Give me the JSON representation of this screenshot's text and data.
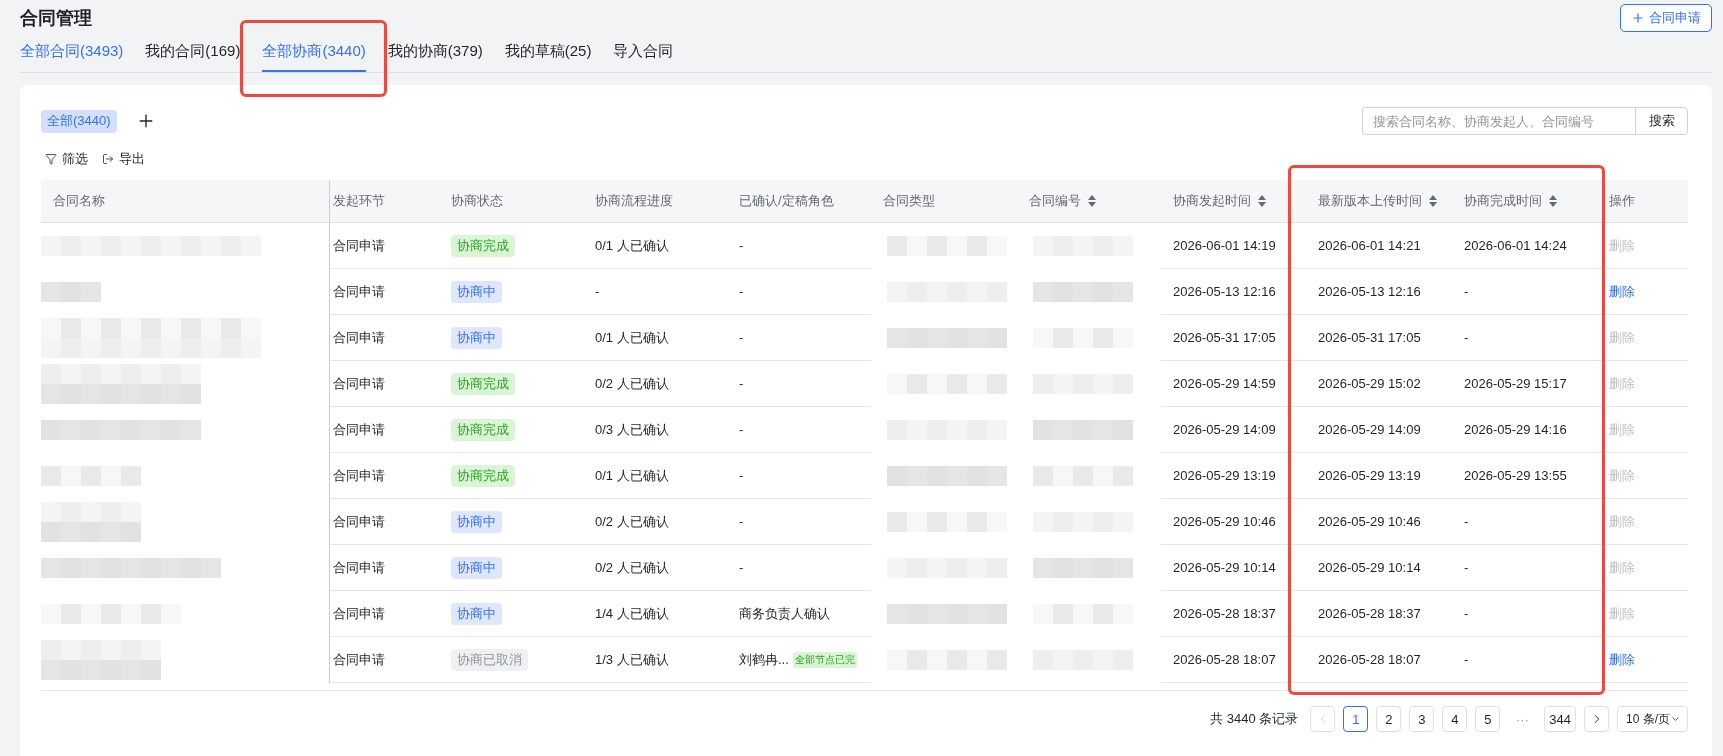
{
  "page": {
    "title": "合同管理",
    "new_button": {
      "label": "合同申请"
    }
  },
  "tabs": [
    {
      "label": "全部合同(3493)",
      "selected": false,
      "highlighted": true,
      "annotated": false
    },
    {
      "label": "我的合同(169)",
      "selected": false,
      "highlighted": false,
      "annotated": false
    },
    {
      "label": "全部协商(3440)",
      "selected": true,
      "highlighted": false,
      "annotated": true
    },
    {
      "label": "我的协商(379)",
      "selected": false,
      "highlighted": false,
      "annotated": false
    },
    {
      "label": "我的草稿(25)",
      "selected": false,
      "highlighted": false,
      "annotated": false
    },
    {
      "label": "导入合同",
      "selected": false,
      "highlighted": false,
      "annotated": false
    }
  ],
  "views": [
    {
      "label": "全部(3440)",
      "selected": true
    }
  ],
  "search": {
    "placeholder": "搜索合同名称、协商发起人、合同编号",
    "button": "搜索"
  },
  "tools": [
    {
      "label": "筛选",
      "kind": "filter"
    },
    {
      "label": "导出",
      "kind": "export"
    }
  ],
  "table": {
    "columns": [
      {
        "label": "合同名称",
        "sortable": false,
        "redacted": true,
        "annotated": false
      },
      {
        "label": "发起环节",
        "sortable": false,
        "redacted": false,
        "annotated": false
      },
      {
        "label": "协商状态",
        "sortable": false,
        "redacted": false,
        "annotated": false
      },
      {
        "label": "协商流程进度",
        "sortable": false,
        "redacted": false,
        "annotated": false
      },
      {
        "label": "已确认/定稿角色",
        "sortable": false,
        "redacted": false,
        "annotated": false
      },
      {
        "label": "合同类型",
        "sortable": false,
        "redacted": true,
        "annotated": false
      },
      {
        "label": "合同编号",
        "sortable": true,
        "redacted": true,
        "annotated": false
      },
      {
        "label": "协商发起时间",
        "sortable": true,
        "redacted": false,
        "annotated": false
      },
      {
        "label": "最新版本上传时间",
        "sortable": true,
        "redacted": false,
        "annotated": true
      },
      {
        "label": "协商完成时间",
        "sortable": true,
        "redacted": false,
        "annotated": true
      },
      {
        "label": "操作",
        "sortable": false,
        "redacted": false,
        "annotated": false
      }
    ],
    "rows": [
      {
        "stage": "合同申请",
        "status": {
          "label": "协商完成",
          "kind": "done"
        },
        "progress": "0/1 人已确认",
        "role": "-",
        "started": "2026-06-01 14:19",
        "latest_upload": "2026-06-01 14:21",
        "completed": "2026-06-01 14:24",
        "action": {
          "label": "删除",
          "disabled": true
        }
      },
      {
        "stage": "合同申请",
        "status": {
          "label": "协商中",
          "kind": "ongoing"
        },
        "progress": "-",
        "role": "-",
        "started": "2026-05-13 12:16",
        "latest_upload": "2026-05-13 12:16",
        "completed": "-",
        "action": {
          "label": "删除",
          "disabled": false
        }
      },
      {
        "stage": "合同申请",
        "status": {
          "label": "协商中",
          "kind": "ongoing"
        },
        "progress": "0/1 人已确认",
        "role": "-",
        "started": "2026-05-31 17:05",
        "latest_upload": "2026-05-31 17:05",
        "completed": "-",
        "action": {
          "label": "删除",
          "disabled": true
        }
      },
      {
        "stage": "合同申请",
        "status": {
          "label": "协商完成",
          "kind": "done"
        },
        "progress": "0/2 人已确认",
        "role": "-",
        "started": "2026-05-29 14:59",
        "latest_upload": "2026-05-29 15:02",
        "completed": "2026-05-29 15:17",
        "action": {
          "label": "删除",
          "disabled": true
        }
      },
      {
        "stage": "合同申请",
        "status": {
          "label": "协商完成",
          "kind": "done"
        },
        "progress": "0/3 人已确认",
        "role": "-",
        "started": "2026-05-29 14:09",
        "latest_upload": "2026-05-29 14:09",
        "completed": "2026-05-29 14:16",
        "action": {
          "label": "删除",
          "disabled": true
        }
      },
      {
        "stage": "合同申请",
        "status": {
          "label": "协商完成",
          "kind": "done"
        },
        "progress": "0/1 人已确认",
        "role": "-",
        "started": "2026-05-29 13:19",
        "latest_upload": "2026-05-29 13:19",
        "completed": "2026-05-29 13:55",
        "action": {
          "label": "删除",
          "disabled": true
        }
      },
      {
        "stage": "合同申请",
        "status": {
          "label": "协商中",
          "kind": "ongoing"
        },
        "progress": "0/2 人已确认",
        "role": "-",
        "started": "2026-05-29 10:46",
        "latest_upload": "2026-05-29 10:46",
        "completed": "-",
        "action": {
          "label": "删除",
          "disabled": true
        }
      },
      {
        "stage": "合同申请",
        "status": {
          "label": "协商中",
          "kind": "ongoing"
        },
        "progress": "0/2 人已确认",
        "role": "-",
        "started": "2026-05-29 10:14",
        "latest_upload": "2026-05-29 10:14",
        "completed": "-",
        "action": {
          "label": "删除",
          "disabled": true
        }
      },
      {
        "stage": "合同申请",
        "status": {
          "label": "协商中",
          "kind": "ongoing"
        },
        "progress": "1/4 人已确认",
        "role": "商务负责人确认",
        "started": "2026-05-28 18:37",
        "latest_upload": "2026-05-28 18:37",
        "completed": "-",
        "action": {
          "label": "删除",
          "disabled": true
        }
      },
      {
        "stage": "合同申请",
        "status": {
          "label": "协商已取消",
          "kind": "cancelled"
        },
        "progress": "1/3 人已确认",
        "role": "刘鹤冉...",
        "role_tag": "全部节点已完",
        "started": "2026-05-28 18:07",
        "latest_upload": "2026-05-28 18:07",
        "completed": "-",
        "action": {
          "label": "删除",
          "disabled": false
        }
      }
    ]
  },
  "pagination": {
    "total": "共 3440 条记录",
    "prev": {
      "disabled": true
    },
    "pages": [
      {
        "label": "1",
        "selected": true
      },
      {
        "label": "2",
        "selected": false
      },
      {
        "label": "3",
        "selected": false
      },
      {
        "label": "4",
        "selected": false
      },
      {
        "label": "5",
        "selected": false
      }
    ],
    "ellipsis": "···",
    "last_pages": [
      {
        "label": "344",
        "selected": false
      }
    ],
    "next": {
      "disabled": false
    },
    "page_size": "10 条/页"
  }
}
